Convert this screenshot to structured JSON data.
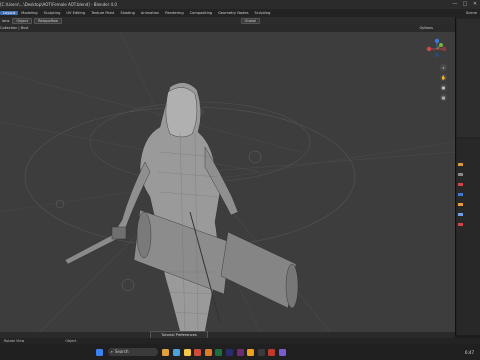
{
  "window": {
    "title": "[C:\\Users\\...\\Desktop\\AOT\\Female AOT.blend] - Blender 4.0",
    "controls": [
      "—",
      "□",
      "✕"
    ]
  },
  "menu": {
    "tabs": [
      "Layout",
      "Modeling",
      "Sculpting",
      "UV Editing",
      "Texture Paint",
      "Shading",
      "Animation",
      "Rendering",
      "Compositing",
      "Geometry Nodes",
      "Scripting"
    ],
    "active": "Layout",
    "scene_label": "Scene"
  },
  "toolbar": {
    "items": [
      "ions",
      "Object",
      "Retopoflow"
    ],
    "transform_orientation": "Global",
    "options_label": "Options"
  },
  "header": {
    "breadcrumb": "Collection | Bust"
  },
  "popup": {
    "label": "Tutorial Preferences"
  },
  "status": {
    "left": "Rotate View",
    "center": "Object"
  },
  "taskbar": {
    "search_label": "Search",
    "time": "6:47"
  },
  "colors": {
    "accent": "#3f6fb5",
    "viewport": "#3d3d3d",
    "axis_x": "#d2454d",
    "axis_y": "#7bb339",
    "axis_z": "#3d78d7"
  }
}
